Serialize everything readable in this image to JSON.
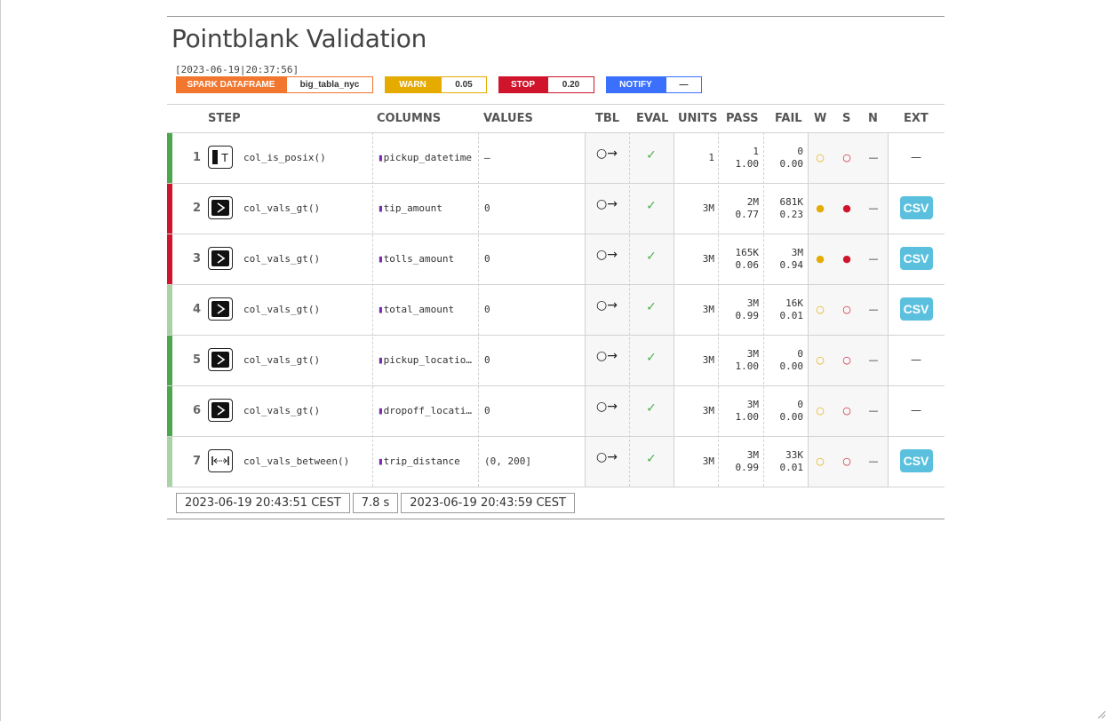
{
  "title": "Pointblank Validation",
  "timestamp_label": "[2023-06-19|20:37:56]",
  "badges": {
    "source_type": "SPARK DATAFRAME",
    "table_name": "big_tabla_nyc",
    "warn_label": "WARN",
    "warn_value": "0.05",
    "stop_label": "STOP",
    "stop_value": "0.20",
    "notify_label": "NOTIFY",
    "notify_value": "—"
  },
  "colors": {
    "source": "#F2762E",
    "warn": "#E5AB00",
    "stop": "#CF142B",
    "notify": "#3A70FB",
    "pass_full": "#4CA64C",
    "pass_partial": "#A9D3A4",
    "fail": "#CF142B",
    "csv": "#5BC0DE"
  },
  "columns": {
    "step": "STEP",
    "columns": "COLUMNS",
    "values": "VALUES",
    "tbl": "TBL",
    "eval": "EVAL",
    "units": "UNITS",
    "pass": "PASS",
    "fail": "FAIL",
    "w": "W",
    "s": "S",
    "n": "N",
    "ext": "EXT"
  },
  "rows": [
    {
      "num": "1",
      "icon": "col-is-posix-icon",
      "fn": "col_is_posix()",
      "col": "pickup_datetime",
      "val": "—",
      "tbl": "○→",
      "eval": "✓",
      "units": "1",
      "pass_n": "1",
      "pass_f": "1.00",
      "fail_n": "0",
      "fail_f": "0.00",
      "w": "○",
      "s": "○",
      "n": "—",
      "ext": "—",
      "status": "pass_full"
    },
    {
      "num": "2",
      "icon": "col-vals-gt-icon",
      "fn": "col_vals_gt()",
      "col": "tip_amount",
      "val": "0",
      "tbl": "○→",
      "eval": "✓",
      "units": "3M",
      "pass_n": "2M",
      "pass_f": "0.77",
      "fail_n": "681K",
      "fail_f": "0.23",
      "w": "●",
      "s": "●",
      "n": "—",
      "ext": "CSV",
      "status": "fail"
    },
    {
      "num": "3",
      "icon": "col-vals-gt-icon",
      "fn": "col_vals_gt()",
      "col": "tolls_amount",
      "val": "0",
      "tbl": "○→",
      "eval": "✓",
      "units": "3M",
      "pass_n": "165K",
      "pass_f": "0.06",
      "fail_n": "3M",
      "fail_f": "0.94",
      "w": "●",
      "s": "●",
      "n": "—",
      "ext": "CSV",
      "status": "fail"
    },
    {
      "num": "4",
      "icon": "col-vals-gt-icon",
      "fn": "col_vals_gt()",
      "col": "total_amount",
      "val": "0",
      "tbl": "○→",
      "eval": "✓",
      "units": "3M",
      "pass_n": "3M",
      "pass_f": "0.99",
      "fail_n": "16K",
      "fail_f": "0.01",
      "w": "○",
      "s": "○",
      "n": "—",
      "ext": "CSV",
      "status": "pass_partial"
    },
    {
      "num": "5",
      "icon": "col-vals-gt-icon",
      "fn": "col_vals_gt()",
      "col": "pickup_locatio…",
      "val": "0",
      "tbl": "○→",
      "eval": "✓",
      "units": "3M",
      "pass_n": "3M",
      "pass_f": "1.00",
      "fail_n": "0",
      "fail_f": "0.00",
      "w": "○",
      "s": "○",
      "n": "—",
      "ext": "—",
      "status": "pass_full"
    },
    {
      "num": "6",
      "icon": "col-vals-gt-icon",
      "fn": "col_vals_gt()",
      "col": "dropoff_locati…",
      "val": "0",
      "tbl": "○→",
      "eval": "✓",
      "units": "3M",
      "pass_n": "3M",
      "pass_f": "1.00",
      "fail_n": "0",
      "fail_f": "0.00",
      "w": "○",
      "s": "○",
      "n": "—",
      "ext": "—",
      "status": "pass_full"
    },
    {
      "num": "7",
      "icon": "col-vals-between-icon",
      "fn": "col_vals_between()",
      "col": "trip_distance",
      "val": "(0, 200]",
      "tbl": "○→",
      "eval": "✓",
      "units": "3M",
      "pass_n": "3M",
      "pass_f": "0.99",
      "fail_n": "33K",
      "fail_f": "0.01",
      "w": "○",
      "s": "○",
      "n": "—",
      "ext": "CSV",
      "status": "pass_partial"
    }
  ],
  "footer": {
    "start_time": "2023-06-19 20:43:51 CEST",
    "duration": "7.8 s",
    "end_time": "2023-06-19 20:43:59 CEST"
  }
}
